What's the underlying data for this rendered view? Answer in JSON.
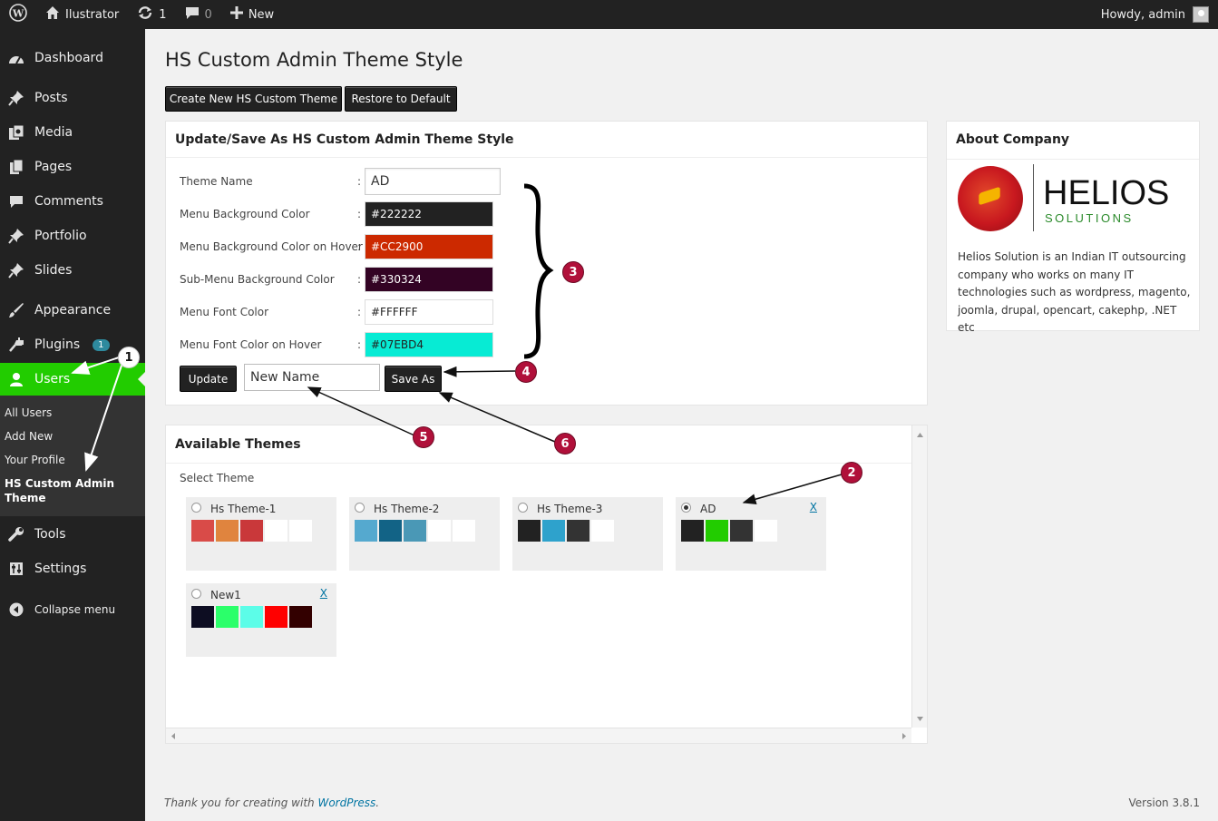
{
  "adminbar": {
    "site_name": "Ilustrator",
    "updates_count": "1",
    "comments_count": "0",
    "new_label": "New",
    "greeting": "Howdy, admin"
  },
  "sidebar": {
    "items": [
      {
        "label": "Dashboard",
        "icon": "dashboard-icon"
      },
      {
        "label": "Posts",
        "icon": "pin-icon"
      },
      {
        "label": "Media",
        "icon": "media-icon"
      },
      {
        "label": "Pages",
        "icon": "pages-icon"
      },
      {
        "label": "Comments",
        "icon": "comment-icon"
      },
      {
        "label": "Portfolio",
        "icon": "portfolio-icon"
      },
      {
        "label": "Slides",
        "icon": "slides-icon"
      },
      {
        "label": "Appearance",
        "icon": "brush-icon"
      },
      {
        "label": "Plugins",
        "icon": "plug-icon",
        "badge": "1"
      },
      {
        "label": "Users",
        "icon": "user-icon"
      },
      {
        "label": "Tools",
        "icon": "wrench-icon"
      },
      {
        "label": "Settings",
        "icon": "settings-icon"
      },
      {
        "label": "Collapse menu",
        "icon": "collapse-icon"
      }
    ],
    "submenu": [
      "All Users",
      "Add New",
      "Your Profile",
      "HS Custom Admin Theme"
    ]
  },
  "page": {
    "title": "HS Custom Admin Theme Style",
    "create_button": "Create New HS Custom Theme",
    "restore_button": "Restore to Default"
  },
  "form": {
    "heading": "Update/Save As HS Custom Admin Theme Style",
    "fields": [
      {
        "label": "Theme Name",
        "value": "AD",
        "color": "#ffffff",
        "text_color": "#333333"
      },
      {
        "label": "Menu Background Color",
        "value": "#222222",
        "color": "#222222",
        "text_color": "#ffffff"
      },
      {
        "label": "Menu Background Color on Hover",
        "value": "#CC2900",
        "color": "#CC2900",
        "text_color": "#ffffff"
      },
      {
        "label": "Sub-Menu Background Color",
        "value": "#330324",
        "color": "#330324",
        "text_color": "#ffffff"
      },
      {
        "label": "Menu Font Color",
        "value": "#FFFFFF",
        "color": "#FFFFFF",
        "text_color": "#222222"
      },
      {
        "label": "Menu Font Color on Hover",
        "value": "#07EBD4",
        "color": "#07EBD4",
        "text_color": "#222222"
      }
    ],
    "colon": ":",
    "update_button": "Update",
    "new_name_value": "New Name",
    "save_as_button": "Save As"
  },
  "themes": {
    "heading": "Available Themes",
    "select_label": "Select Theme",
    "delete_label": "X",
    "items": [
      {
        "name": "Hs Theme-1",
        "selected": false,
        "deletable": false,
        "colors": [
          "#d94b48",
          "#e0843e",
          "#c9383a",
          "#ffffff",
          "#ffffff"
        ]
      },
      {
        "name": "Hs Theme-2",
        "selected": false,
        "deletable": false,
        "colors": [
          "#55a9cf",
          "#126386",
          "#4a98b6",
          "#ffffff",
          "#ffffff"
        ]
      },
      {
        "name": "Hs Theme-3",
        "selected": false,
        "deletable": false,
        "colors": [
          "#222222",
          "#2ea2cc",
          "#333333",
          "#ffffff",
          "#eeeeee"
        ]
      },
      {
        "name": "AD",
        "selected": true,
        "deletable": true,
        "colors": [
          "#222222",
          "#22cc00",
          "#333333",
          "#ffffff",
          "#eeeeee"
        ]
      },
      {
        "name": "New1",
        "selected": false,
        "deletable": true,
        "colors": [
          "#0d0d22",
          "#2bff6a",
          "#5cfde8",
          "#ff0000",
          "#330000"
        ]
      }
    ]
  },
  "about": {
    "heading": "About Company",
    "brand": "HELIOS",
    "brand_sub": "SOLUTIONS",
    "text": "Helios Solution is an Indian IT outsourcing company who works on many IT technologies such as wordpress, magento, joomla, drupal, opencart, cakephp, .NET etc"
  },
  "footer": {
    "thanks_prefix": "Thank you for creating with ",
    "thanks_link": "WordPress",
    "thanks_suffix": ".",
    "version": "Version 3.8.1"
  },
  "annotations": [
    "1",
    "2",
    "3",
    "4",
    "5",
    "6"
  ]
}
